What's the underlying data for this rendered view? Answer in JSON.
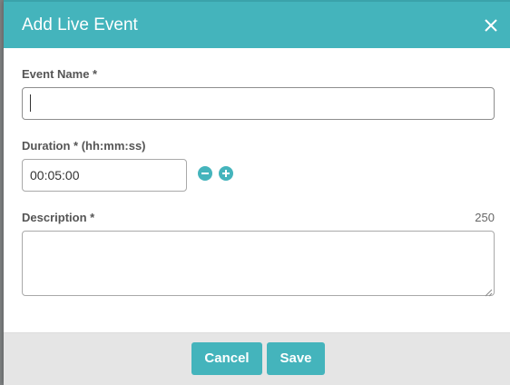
{
  "dialog": {
    "title": "Add Live Event",
    "close_icon": "close-icon"
  },
  "form": {
    "event_name": {
      "label": "Event Name *",
      "value": ""
    },
    "duration": {
      "label": "Duration * (hh:mm:ss)",
      "value": "00:05:00",
      "decrement_icon": "minus-circle-icon",
      "increment_icon": "plus-circle-icon"
    },
    "description": {
      "label": "Description *",
      "remaining_chars": "250",
      "value": ""
    }
  },
  "footer": {
    "cancel_label": "Cancel",
    "save_label": "Save"
  },
  "colors": {
    "accent": "#44b4bc",
    "footer_bg": "#e5e5e5",
    "overlay": "#7f8283"
  }
}
